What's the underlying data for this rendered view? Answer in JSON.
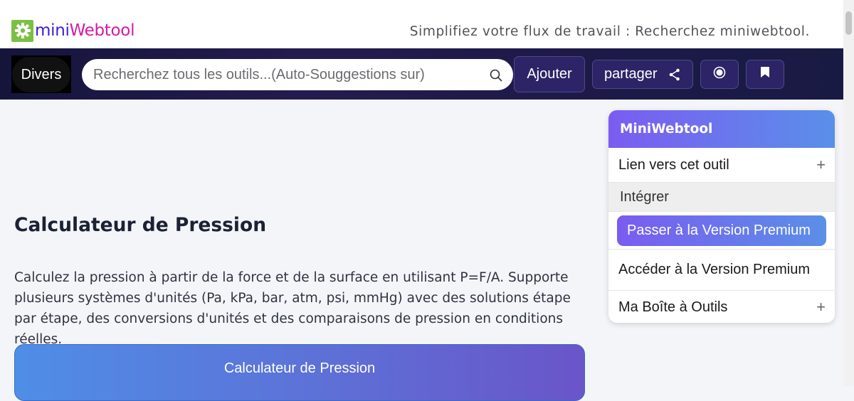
{
  "header": {
    "logo": {
      "icon": "gear-icon",
      "part1": "mini",
      "part2": "Webtool",
      "color1": "#3a1fd1",
      "color2": "#d41aa8",
      "icon_bg": "#7bc043"
    },
    "tagline": "Simplifiez votre flux de travail : Recherchez miniwebtool."
  },
  "nav": {
    "divers_label": "Divers",
    "search_placeholder": "Recherchez tous les outils...(Auto-Souggestions sur)",
    "search_icon": "search-icon",
    "add_label": "Ajouter",
    "share_label": "partager",
    "share_icon": "share-icon",
    "record_icon": "record-icon",
    "bookmark_icon": "bookmark-icon"
  },
  "main": {
    "title": "Calculateur de Pression",
    "description": "Calculez la pression à partir de la force et de la surface en utilisant P=F/A. Supporte plusieurs systèmes d'unités (Pa, kPa, bar, atm, psi, mmHg) avec des solutions étape par étape, des conversions d'unités et des comparaisons de pression en conditions réelles.",
    "card_title": "Calculateur de Pression"
  },
  "sidebar": {
    "header": "MiniWebtool",
    "link_label": "Lien vers cet outil",
    "embed_label": "Intégrer",
    "upgrade_label": "Passer à la Version Premium",
    "access_label": "Accéder à la Version Premium",
    "toolbox_label": "Ma Boîte à Outils",
    "plus": "+"
  },
  "colors": {
    "accent_purple": "#7b5cf0",
    "accent_blue": "#5a8fea",
    "nav_bg": "#1d1a48"
  }
}
